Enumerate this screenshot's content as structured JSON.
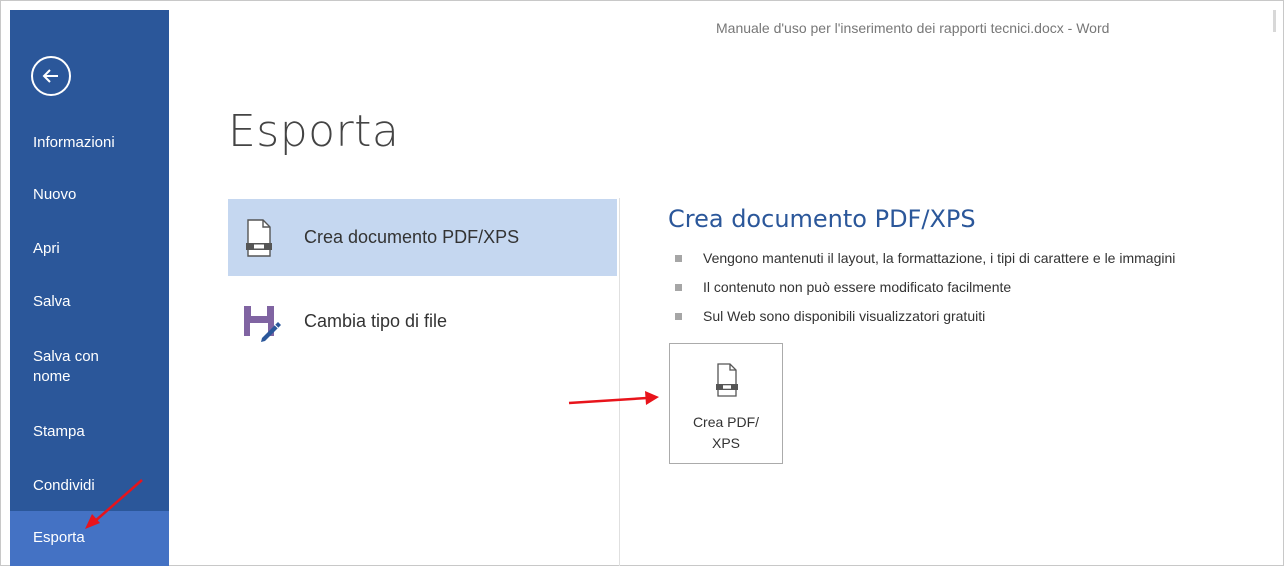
{
  "window": {
    "title": "Manuale d'uso per l'inserimento dei rapporti tecnici.docx - Word"
  },
  "sidebar": {
    "back_icon": "back-arrow-icon",
    "items": [
      {
        "label": "Informazioni"
      },
      {
        "label": "Nuovo"
      },
      {
        "label": "Apri"
      },
      {
        "label": "Salva"
      },
      {
        "label": "Salva con nome"
      },
      {
        "label": "Stampa"
      },
      {
        "label": "Condividi"
      },
      {
        "label": "Esporta",
        "selected": true
      }
    ],
    "colors": {
      "background": "#2b579a",
      "selected": "#4472c4"
    }
  },
  "main": {
    "title": "Esporta",
    "options": [
      {
        "label": "Crea documento PDF/XPS",
        "icon": "pdf-document-icon",
        "selected": true
      },
      {
        "label": "Cambia tipo di file",
        "icon": "save-as-icon",
        "selected": false
      }
    ]
  },
  "detail": {
    "heading": "Crea documento PDF/XPS",
    "bullets": [
      "Vengono mantenuti il layout, la formattazione, i tipi di carattere e le immagini",
      "Il contenuto non può essere modificato facilmente",
      "Sul Web sono disponibili visualizzatori gratuiti"
    ],
    "button": {
      "line1": "Crea PDF/",
      "line2": "XPS",
      "icon": "pdf-document-icon"
    }
  },
  "annotations": {
    "arrow_color": "#e8141b"
  }
}
